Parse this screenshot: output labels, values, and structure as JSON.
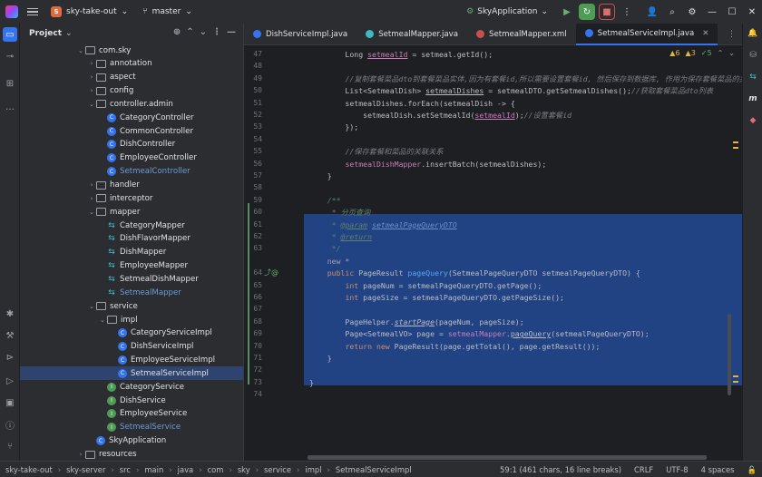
{
  "titlebar": {
    "project_badge": "S",
    "project_name": "sky-take-out",
    "branch": "master",
    "run_config": "SkyApplication"
  },
  "project_panel": {
    "title": "Project",
    "tree": [
      {
        "label": "com.sky",
        "type": "folder",
        "depth": 0,
        "expanded": true
      },
      {
        "label": "annotation",
        "type": "folder",
        "depth": 1,
        "expanded": false
      },
      {
        "label": "aspect",
        "type": "folder",
        "depth": 1,
        "expanded": false
      },
      {
        "label": "config",
        "type": "folder",
        "depth": 1,
        "expanded": false
      },
      {
        "label": "controller.admin",
        "type": "folder",
        "depth": 1,
        "expanded": true
      },
      {
        "label": "CategoryController",
        "type": "class",
        "depth": 2
      },
      {
        "label": "CommonController",
        "type": "class",
        "depth": 2
      },
      {
        "label": "DishController",
        "type": "class",
        "depth": 2
      },
      {
        "label": "EmployeeController",
        "type": "class",
        "depth": 2
      },
      {
        "label": "SetmealController",
        "type": "class",
        "depth": 2,
        "blue": true
      },
      {
        "label": "handler",
        "type": "folder",
        "depth": 1,
        "expanded": false
      },
      {
        "label": "interceptor",
        "type": "folder",
        "depth": 1,
        "expanded": false
      },
      {
        "label": "mapper",
        "type": "folder",
        "depth": 1,
        "expanded": true
      },
      {
        "label": "CategoryMapper",
        "type": "mybatis",
        "depth": 2
      },
      {
        "label": "DishFlavorMapper",
        "type": "mybatis",
        "depth": 2
      },
      {
        "label": "DishMapper",
        "type": "mybatis",
        "depth": 2
      },
      {
        "label": "EmployeeMapper",
        "type": "mybatis",
        "depth": 2
      },
      {
        "label": "SetmealDishMapper",
        "type": "mybatis",
        "depth": 2
      },
      {
        "label": "SetmealMapper",
        "type": "mybatis",
        "depth": 2,
        "blue": true
      },
      {
        "label": "service",
        "type": "folder",
        "depth": 1,
        "expanded": true
      },
      {
        "label": "impl",
        "type": "folder",
        "depth": 2,
        "expanded": true
      },
      {
        "label": "CategoryServiceImpl",
        "type": "class",
        "depth": 3
      },
      {
        "label": "DishServiceImpl",
        "type": "class",
        "depth": 3
      },
      {
        "label": "EmployeeServiceImpl",
        "type": "class",
        "depth": 3
      },
      {
        "label": "SetmealServiceImpl",
        "type": "class",
        "depth": 3,
        "selected": true
      },
      {
        "label": "CategoryService",
        "type": "iface",
        "depth": 2
      },
      {
        "label": "DishService",
        "type": "iface",
        "depth": 2
      },
      {
        "label": "EmployeeService",
        "type": "iface",
        "depth": 2
      },
      {
        "label": "SetmealService",
        "type": "iface",
        "depth": 2,
        "blue": true
      },
      {
        "label": "SkyApplication",
        "type": "app",
        "depth": 1
      },
      {
        "label": "resources",
        "type": "folder",
        "depth": 0,
        "expanded": false
      }
    ]
  },
  "editor": {
    "tabs": [
      {
        "label": "DishServiceImpl.java",
        "active": false,
        "color": "#3574f0",
        "closable": false
      },
      {
        "label": "SetmealMapper.java",
        "active": false,
        "color": "#3fb8c4",
        "closable": false
      },
      {
        "label": "SetmealMapper.xml",
        "active": false,
        "color": "#c94f4f",
        "closable": false
      },
      {
        "label": "SetmealServiceImpl.java",
        "active": true,
        "color": "#3574f0",
        "closable": true
      }
    ],
    "inspections": {
      "warnings": "6",
      "weak": "3",
      "ok": "5"
    },
    "lines": [
      {
        "n": "47",
        "html": "        Long <span class=\"fld\" style=\"text-decoration:underline\">setmealId</span> = setmeal.getId();"
      },
      {
        "n": "48",
        "html": ""
      },
      {
        "n": "49",
        "html": "        <span class=\"cm\">//复制套餐菜品dto到套餐菜品实体,因为有套餐id,所以需要设置套餐id, 然后保存到数据库, 作用为保存套餐菜品的关联关系</span>"
      },
      {
        "n": "50",
        "html": "        List&lt;SetmealDish&gt; <span style=\"text-decoration:underline\">setmealDishes</span> = setmealDTO.getSetmealDishes();<span class=\"cm\">//获取套餐菜品dto列表</span>"
      },
      {
        "n": "51",
        "html": "        setmealDishes.forEach(setmealDish -&gt; {"
      },
      {
        "n": "52",
        "html": "            setmealDish.setSetmealId(<span class=\"fld\" style=\"text-decoration:underline\">setmealId</span>);<span class=\"cm\">//设置套餐id</span>"
      },
      {
        "n": "53",
        "html": "        });"
      },
      {
        "n": "54",
        "html": ""
      },
      {
        "n": "55",
        "html": "        <span class=\"cm\">//保存套餐和菜品的关联关系</span>"
      },
      {
        "n": "56",
        "html": "        <span class=\"fld\">setmealDishMapper</span>.insertBatch(setmealDishes);"
      },
      {
        "n": "57",
        "html": "    }"
      },
      {
        "n": "58",
        "html": ""
      },
      {
        "n": "59",
        "html": "    <span class=\"doc\">/**</span>"
      },
      {
        "n": "60",
        "html": "<span class=\"doc\">     * 分页查询</span>"
      },
      {
        "n": "61",
        "html": "<span class=\"doc\">     * <span style=\"text-decoration:underline\">@param</span> <span class=\"tag\">setmealPageQueryDTO</span></span>"
      },
      {
        "n": "62",
        "html": "<span class=\"doc\">     * <span style=\"text-decoration:underline\">@return</span></span>"
      },
      {
        "n": "63",
        "html": "<span class=\"doc\">     */</span>"
      },
      {
        "n": "",
        "html": "    <span class=\"hint\">new *</span>"
      },
      {
        "n": "64",
        "html": "    <span class=\"kw\">public</span> PageResult <span class=\"fn\">pageQuery</span>(SetmealPageQueryDTO setmealPageQueryDTO) {"
      },
      {
        "n": "65",
        "html": "        <span class=\"kw\">int</span> pageNum = setmealPageQueryDTO.getPage();"
      },
      {
        "n": "66",
        "html": "        <span class=\"kw\">int</span> pageSize = setmealPageQueryDTO.getPageSize();"
      },
      {
        "n": "67",
        "html": ""
      },
      {
        "n": "68",
        "html": "        PageHelper.<span style=\"font-style:italic;text-decoration:underline\">startPage</span>(pageNum, pageSize);"
      },
      {
        "n": "69",
        "html": "        Page&lt;SetmealVO&gt; page = <span class=\"fld\">setmealMapper</span>.<span style=\"text-decoration:underline\">pageQuery</span>(setmealPageQueryDTO);"
      },
      {
        "n": "70",
        "html": "        <span class=\"kw\">return new</span> PageResult(page.getTotal(), page.getResult());"
      },
      {
        "n": "71",
        "html": "    }"
      },
      {
        "n": "72",
        "html": ""
      },
      {
        "n": "73",
        "html": "}"
      },
      {
        "n": "74",
        "html": ""
      }
    ]
  },
  "statusbar": {
    "breadcrumbs": [
      "sky-take-out",
      "sky-server",
      "src",
      "main",
      "java",
      "com",
      "sky",
      "service",
      "impl",
      "SetmealServiceImpl"
    ],
    "position": "59:1 (461 chars, 16 line breaks)",
    "line_ending": "CRLF",
    "encoding": "UTF-8",
    "indent": "4 spaces"
  }
}
